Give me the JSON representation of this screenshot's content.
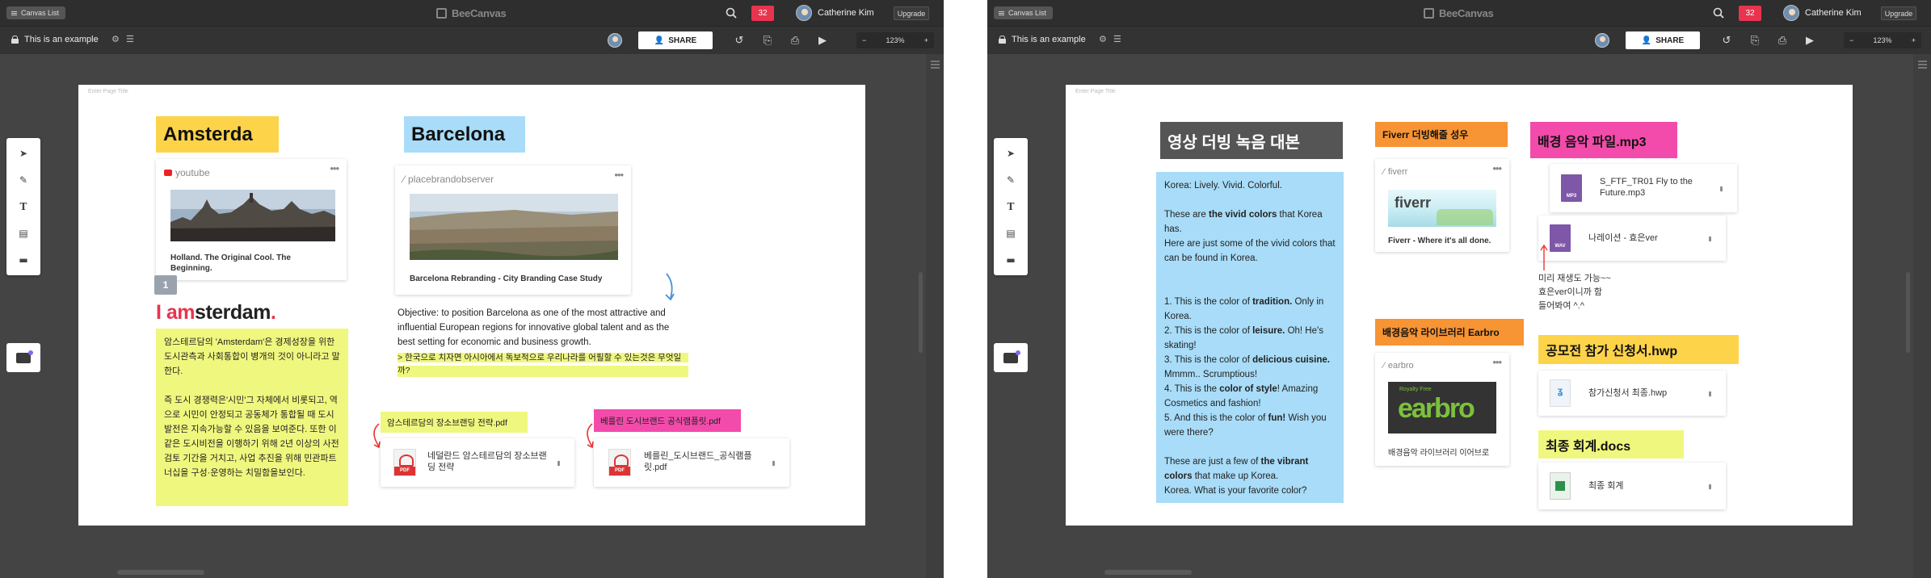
{
  "topbar": {
    "canvas_list": "Canvas List",
    "logo": "BeeCanvas",
    "badge": "32",
    "user": "Catherine Kim",
    "upgrade": "Upgrade"
  },
  "subbar": {
    "title": "This is an example",
    "share": "SHARE",
    "zoom": "123%",
    "zoom_minus": "−",
    "zoom_plus": "+"
  },
  "page_title_placeholder": "Enter Page Title",
  "left": {
    "amsterdam_header": "Amsterda",
    "barcelona_header": "Barcelona",
    "yt_source": "youtube",
    "yt_caption": "Holland. The Original Cool. The Beginning.",
    "page_num": "1",
    "iam_i": "I ",
    "iam_am": "am",
    "iam_rest": "sterdam",
    "pb_source": "placebrandobserver",
    "pb_caption": "Barcelona Rebranding - City Branding Case Study",
    "objective": "Objective: to position Barcelona as one of the most attractive and influential European regions for innovative global talent and as the best setting for economic and business growth.",
    "objective_kr": "> 한국으로 치자면 아시아에서 독보적으로 우리나라를 어필할 수 있는것은 무엇일까?",
    "ams_note_1": "암스테르담의 'Amsterdam'은 경제성장을 위한 도시관측과 사회통합이 병개의 것이 아니라고 말한다.",
    "ams_note_2": "즉 도시 경쟁력은'시민'그 자체에서 비롯되고, 역으로 시민이 안정되고 공동체가 통합될 때 도시발전은 지속가능할 수 있음을 보여준다. 또한 이 같은 도시비전을 이행하기 위해 2년 이상의 사전검토 기간을 거치고, 사업 추진을 위해 민관파트너십을 구성·운영하는 치밀함을보인다.",
    "label_ams_pdf": "암스테르담의 장소브랜딩 전략.pdf",
    "label_bcn_pdf": "베를린 도시브랜드 공식램플릿.pdf",
    "file1": "네덜란드 암스테르담의 장소브랜딩 전략",
    "file2": "베를린_도시브랜드_공식램플릿.pdf",
    "pdf": "PDF"
  },
  "right": {
    "dub_header": "영상 더빙 녹음 대본",
    "dub_note": {
      "l1": "Korea: Lively. Vivid. Colorful.",
      "l2a": "These are ",
      "l2b": "the vivid colors",
      "l2c": " that Korea has.",
      "l3": "Here are just some of the vivid colors that can be found in Korea.",
      "i1a": "1. This is the color of ",
      "i1b": "tradition.",
      "i1c": " Only in Korea.",
      "i2a": "2. This is the color of ",
      "i2b": "leisure.",
      "i2c": " Oh! He's skating!",
      "i3a": "3. This is the color of ",
      "i3b": "delicious cuisine.",
      "i3c": " Mmmm.. Scrumptious!",
      "i4a": "4. This is the ",
      "i4b": "color of style",
      "i4c": "! Amazing Cosmetics and fashion!",
      "i5a": "5. And this is the color of ",
      "i5b": "fun!",
      "i5c": " Wish you were there?",
      "e1a": "These are just a few of ",
      "e1b": "the vibrant colors",
      "e1c": " that make up Korea.",
      "e2": "Korea.  What is your favorite color?"
    },
    "fiverr_header": "Fiverr 더빙해줄 성우",
    "fiverr_source": "fiverr",
    "fiverr_logo": "fiverr",
    "fiverr_caption": "Fiverr - Where it's all done.",
    "earbro_header": "배경음악 라이브러리 Earbro",
    "earbro_source": "earbro",
    "earbro_tag": "Royalty Free",
    "earbro_logo": "earbro",
    "earbro_caption": "배경음악 라이브러리 이어브로",
    "bgm_header": "배경 음악 파일.mp3",
    "mp3_file": "S_FTF_TR01 Fly to the Future.mp3",
    "mp3": "MP3",
    "wav_file": "나레이션 - 효은ver",
    "wav": "WAV",
    "handnote": [
      "미리 재생도 가능~~",
      "효은ver이니까 함",
      "들어봐여 ^.^"
    ],
    "apply_header": "공모전 참가 신청서.hwp",
    "hwp_file": "참가신청서 최종.hwp",
    "docs_header": "최종 회계.docs",
    "doc_file": "최종 회계"
  },
  "colors": {
    "yellow": "#fdd34a",
    "blue": "#a8dcf8",
    "lime": "#f0f77e",
    "orange": "#f79433",
    "pink": "#f24bab",
    "dark": "#555",
    "red": "#e8344e"
  }
}
